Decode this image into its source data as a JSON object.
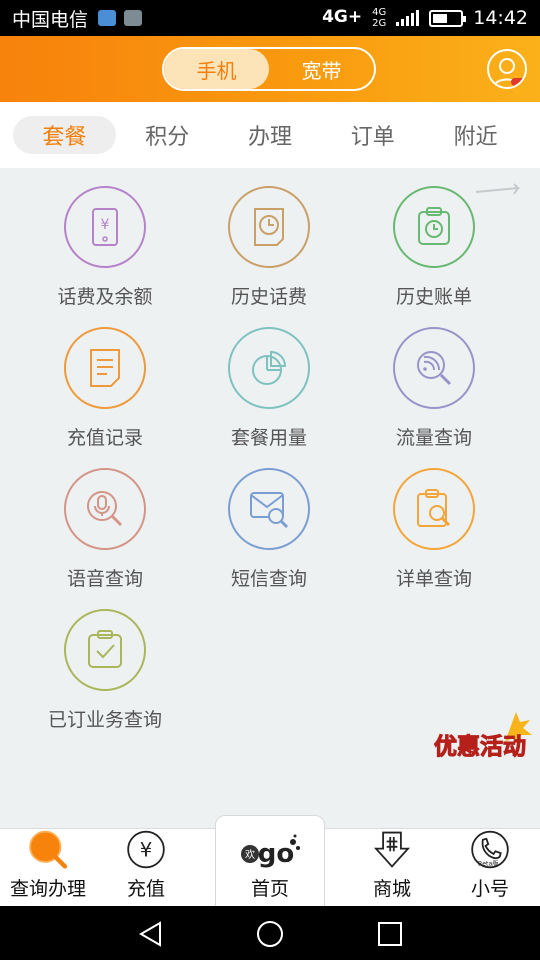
{
  "status_bar": {
    "carrier": "中国电信",
    "network_top": "4G+",
    "network_sub_a": "4G",
    "network_sub_b": "2G",
    "time": "14:42",
    "battery_level": 0.55
  },
  "header": {
    "segments": [
      {
        "label": "手机",
        "active": true
      },
      {
        "label": "宽带",
        "active": false
      }
    ],
    "avatar_icon": "user-avatar-icon"
  },
  "tabs": [
    {
      "label": "套餐",
      "active": true
    },
    {
      "label": "积分",
      "active": false
    },
    {
      "label": "办理",
      "active": false
    },
    {
      "label": "订单",
      "active": false
    },
    {
      "label": "附近",
      "active": false
    }
  ],
  "features": [
    {
      "label": "话费及余额",
      "icon": "phone-yuan-icon",
      "color": "#b583c9"
    },
    {
      "label": "历史话费",
      "icon": "clock-document-icon",
      "color": "#c9a067"
    },
    {
      "label": "历史账单",
      "icon": "clock-clipboard-icon",
      "color": "#67b871"
    },
    {
      "label": "充值记录",
      "icon": "document-lines-icon",
      "color": "#ee9a3c"
    },
    {
      "label": "套餐用量",
      "icon": "pie-chart-icon",
      "color": "#7ec2c0"
    },
    {
      "label": "流量查询",
      "icon": "signal-search-icon",
      "color": "#9a93c9"
    },
    {
      "label": "语音查询",
      "icon": "microphone-search-icon",
      "color": "#d49486"
    },
    {
      "label": "短信查询",
      "icon": "message-search-icon",
      "color": "#7a9ed2"
    },
    {
      "label": "详单查询",
      "icon": "clipboard-search-icon",
      "color": "#f4a53a"
    },
    {
      "label": "已订业务查询",
      "icon": "clipboard-check-icon",
      "color": "#aab65a"
    }
  ],
  "promo": {
    "text": "优惠活动",
    "color": "#e8322a",
    "accent": "#f7b51b"
  },
  "bottom_nav": [
    {
      "label": "查询办理",
      "icon": "search-orange-icon",
      "active": true
    },
    {
      "label": "充值",
      "icon": "yuan-circle-icon",
      "active": false
    },
    {
      "label": "首页",
      "icon": "egoo-logo-icon",
      "logo_text": "go",
      "logo_sub": "欢",
      "active": false
    },
    {
      "label": "商城",
      "icon": "shop-arrow-icon",
      "active": false
    },
    {
      "label": "小号",
      "icon": "phone-beta-icon",
      "badge": "Beta版",
      "active": false
    }
  ],
  "colors": {
    "brand_orange": "#f7820c",
    "brand_yellow": "#fbb11a",
    "active_text": "#f27f0a"
  }
}
